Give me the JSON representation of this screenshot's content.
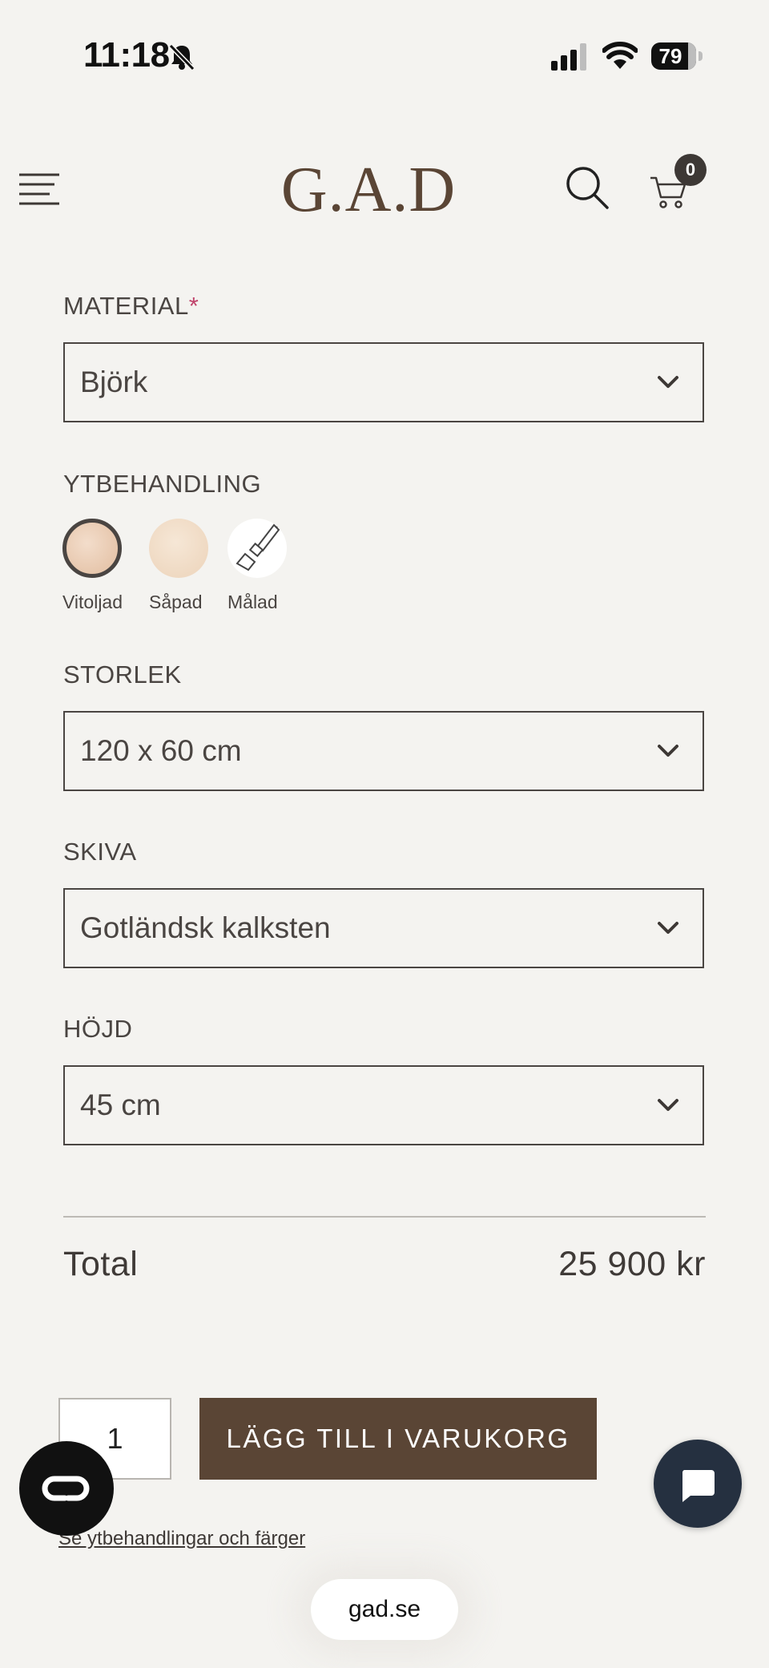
{
  "status_bar": {
    "time": "11:18",
    "battery": "79"
  },
  "header": {
    "logo": "G.A.D",
    "cart_count": "0"
  },
  "material": {
    "label": "MATERIAL",
    "required_mark": "*",
    "value": "Björk"
  },
  "finish": {
    "label": "YTBEHANDLING",
    "options": [
      {
        "label": "Vitoljad",
        "selected": true
      },
      {
        "label": "Såpad",
        "selected": false
      },
      {
        "label": "Målad",
        "selected": false
      }
    ]
  },
  "size": {
    "label": "STORLEK",
    "value": "120 x 60 cm"
  },
  "top": {
    "label": "SKIVA",
    "value": "Gotländsk kalksten"
  },
  "height": {
    "label": "HÖJD",
    "value": "45 cm"
  },
  "total": {
    "label": "Total",
    "value": "25 900 kr"
  },
  "cart_form": {
    "quantity": "1",
    "add_button": "LÄGG TILL I VARUKORG"
  },
  "finishes_link": "Se ytbehandlingar och färger",
  "browser": {
    "url": "gad.se"
  },
  "colors": {
    "brand": "#5a4535",
    "background": "#f4f3f0",
    "required": "#c0436b",
    "chat": "#253040"
  }
}
